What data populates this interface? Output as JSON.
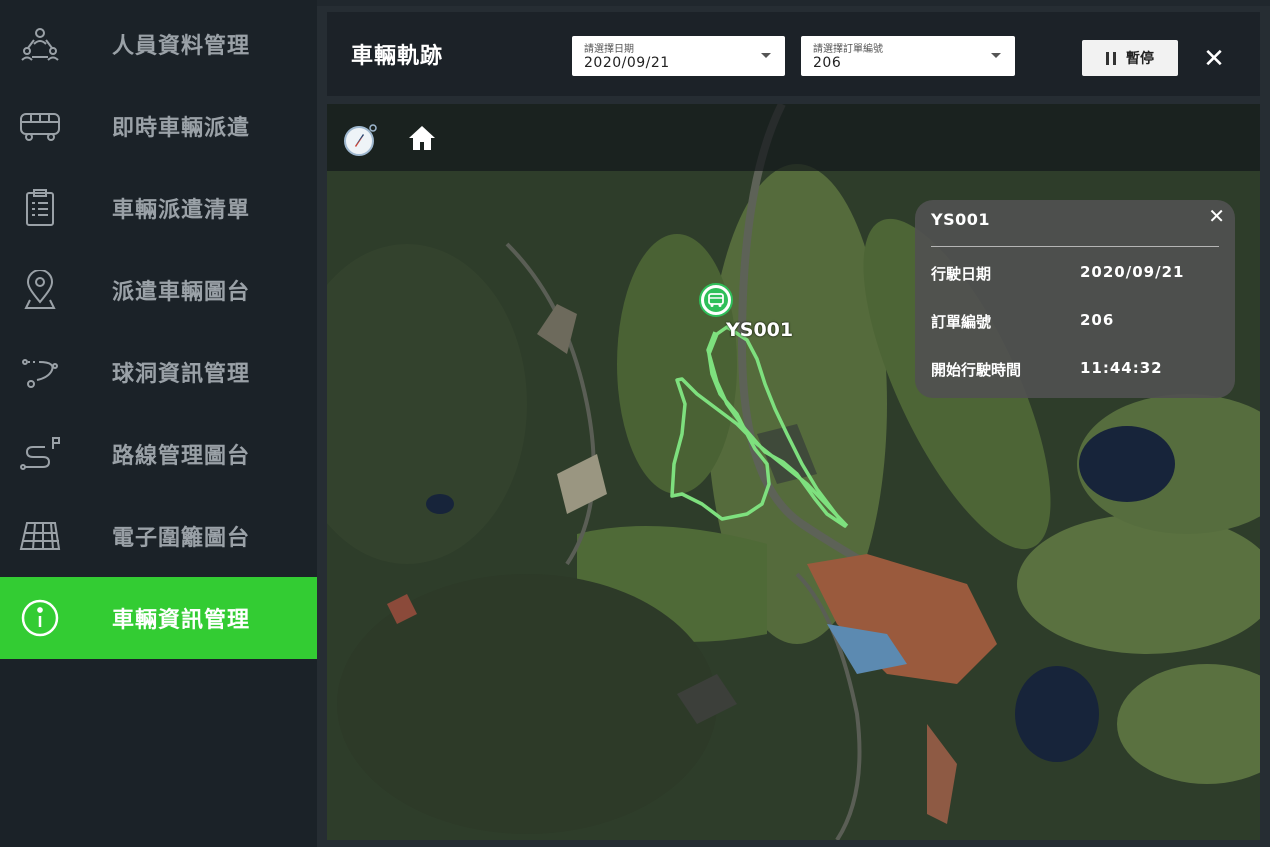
{
  "sidebar": {
    "items": [
      {
        "label": "人員資料管理",
        "icon": "people-network-icon",
        "active": false
      },
      {
        "label": "即時車輛派遣",
        "icon": "bus-icon",
        "active": false
      },
      {
        "label": "車輛派遣清單",
        "icon": "clipboard-list-icon",
        "active": false
      },
      {
        "label": "派遣車輛圖台",
        "icon": "map-pin-icon",
        "active": false
      },
      {
        "label": "球洞資訊管理",
        "icon": "route-dots-icon",
        "active": false
      },
      {
        "label": "路線管理圖台",
        "icon": "route-flag-icon",
        "active": false
      },
      {
        "label": "電子圍籬圖台",
        "icon": "geofence-grid-icon",
        "active": false
      },
      {
        "label": "車輛資訊管理",
        "icon": "info-circle-icon",
        "active": true
      }
    ]
  },
  "header": {
    "title": "車輛軌跡",
    "date_select": {
      "label": "請選擇日期",
      "value": "2020/09/21"
    },
    "order_select": {
      "label": "請選擇訂單編號",
      "value": "206"
    },
    "pause_label": "暫停",
    "close_glyph": "✕"
  },
  "map": {
    "vehicle_label": "YS001",
    "track_color": "#7ee07e",
    "accent_color": "#33cc33",
    "popup": {
      "title": "YS001",
      "close_glyph": "✕",
      "rows": [
        {
          "key": "行駛日期",
          "value": "2020/09/21"
        },
        {
          "key": "訂單編號",
          "value": "206"
        },
        {
          "key": "開始行駛時間",
          "value": "11:44:32"
        }
      ]
    }
  }
}
